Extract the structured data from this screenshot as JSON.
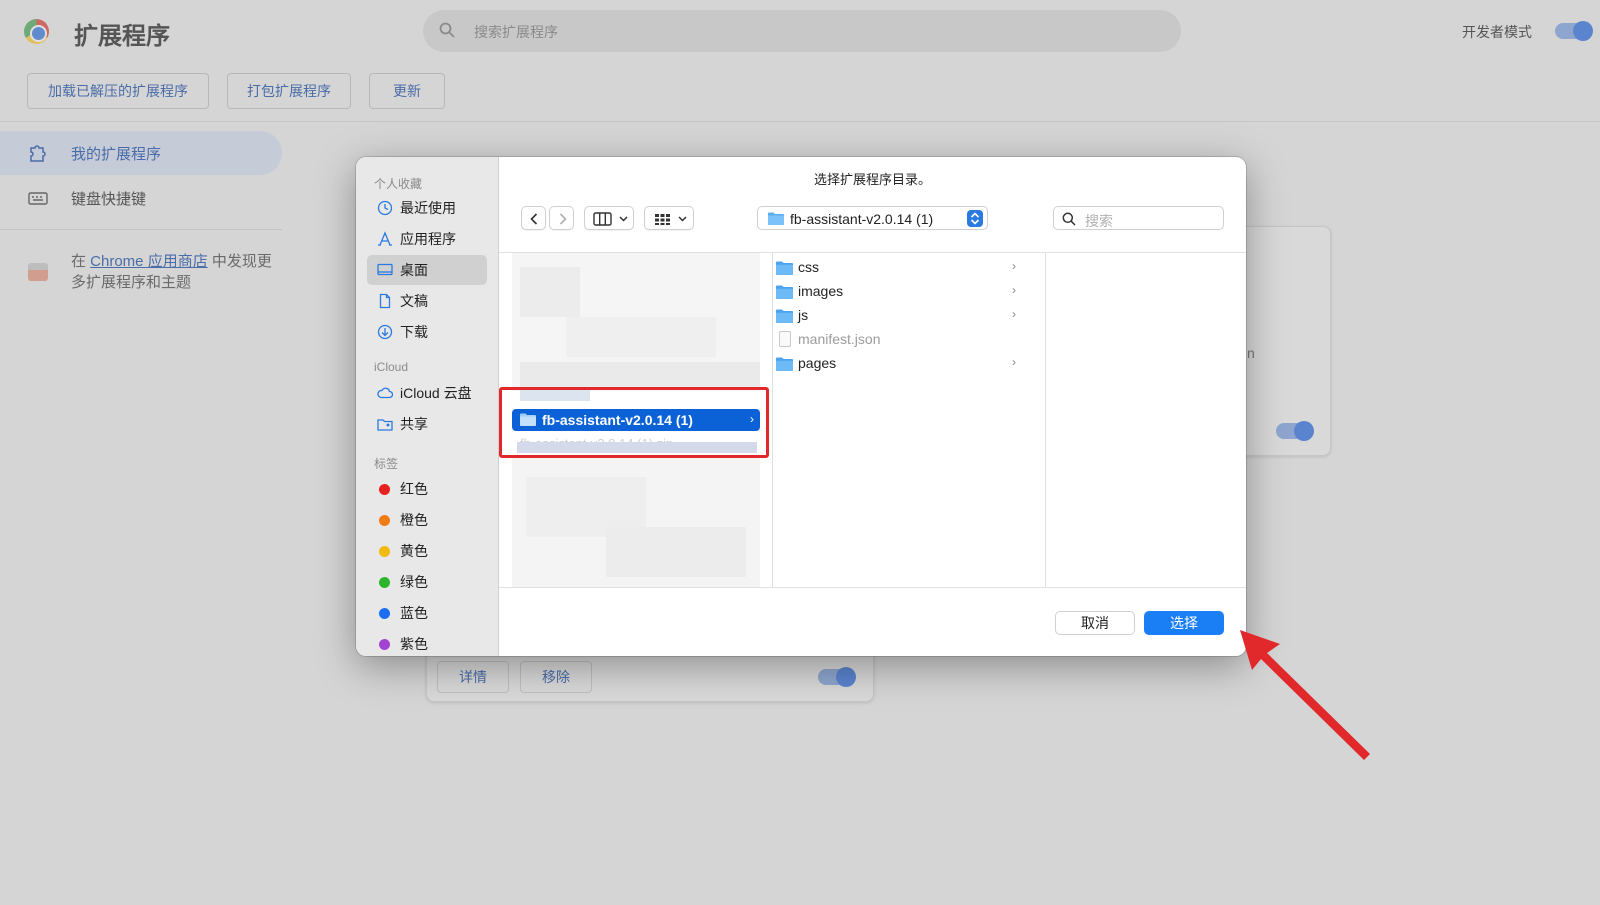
{
  "page": {
    "title": "扩展程序",
    "search_placeholder": "搜索扩展程序",
    "developer_mode_label": "开发者模式",
    "toolbar": {
      "load_unpacked": "加载已解压的扩展程序",
      "pack": "打包扩展程序",
      "update": "更新"
    },
    "sidebar": {
      "my_extensions": "我的扩展程序",
      "keyboard_shortcuts": "键盘快捷键",
      "store_prefix": "在 ",
      "store_link": "Chrome 应用商店",
      "store_suffix": " 中发现更多扩展程序和主题"
    },
    "card": {
      "details_button": "详情",
      "remove_button": "移除",
      "partial_text": "n"
    }
  },
  "dialog": {
    "title": "选择扩展程序目录。",
    "location": "fb-assistant-v2.0.14 (1)",
    "search_placeholder": "搜索",
    "sidebar": {
      "favorites_header": "个人收藏",
      "favorites": [
        {
          "label": "最近使用",
          "icon": "clock-icon"
        },
        {
          "label": "应用程序",
          "icon": "applications-icon"
        },
        {
          "label": "桌面",
          "icon": "desktop-icon"
        },
        {
          "label": "文稿",
          "icon": "document-icon"
        },
        {
          "label": "下载",
          "icon": "download-icon"
        }
      ],
      "icloud_header": "iCloud",
      "icloud": [
        {
          "label": "iCloud 云盘",
          "icon": "cloud-icon"
        },
        {
          "label": "共享",
          "icon": "shared-folder-icon"
        }
      ],
      "tags_header": "标签",
      "tags": [
        {
          "label": "红色",
          "color": "#e8201e"
        },
        {
          "label": "橙色",
          "color": "#f07a14"
        },
        {
          "label": "黄色",
          "color": "#f2b90f"
        },
        {
          "label": "绿色",
          "color": "#2cb52c"
        },
        {
          "label": "蓝色",
          "color": "#1b6ef2"
        },
        {
          "label": "紫色",
          "color": "#a044d1"
        }
      ]
    },
    "selected_folder": "fb-assistant-v2.0.14 (1)",
    "faded_item": "fb-assistant-v2.0.14 (1).zip",
    "folder_contents": [
      {
        "name": "css",
        "type": "folder"
      },
      {
        "name": "images",
        "type": "folder"
      },
      {
        "name": "js",
        "type": "folder"
      },
      {
        "name": "manifest.json",
        "type": "file"
      },
      {
        "name": "pages",
        "type": "folder"
      }
    ],
    "cancel_label": "取消",
    "choose_label": "选择"
  },
  "colors": {
    "accent": "#1a7ef5",
    "selection": "#0b62d6",
    "annotation": "#e1282b"
  }
}
